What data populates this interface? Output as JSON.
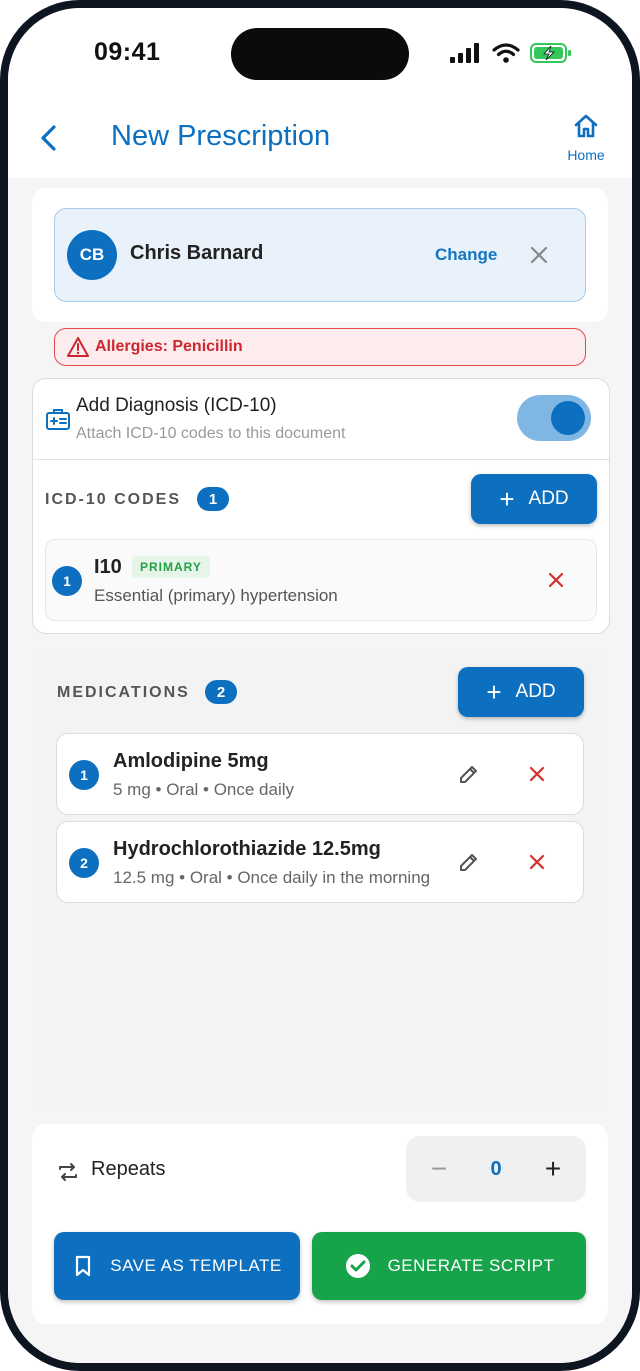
{
  "status_bar": {
    "time": "09:41"
  },
  "header": {
    "title": "New Prescription",
    "home_label": "Home"
  },
  "patient": {
    "initials": "CB",
    "name": "Chris Barnard",
    "change_label": "Change"
  },
  "allergy": {
    "text": "Allergies: Penicillin"
  },
  "diagnosis": {
    "title": "Add Diagnosis (ICD-10)",
    "subtitle": "Attach ICD-10 codes to this document",
    "enabled": true,
    "section_label": "ICD-10 CODES",
    "count": "1",
    "add_label": "ADD",
    "codes": [
      {
        "index": "1",
        "code": "I10",
        "tag": "PRIMARY",
        "description": "Essential (primary) hypertension"
      }
    ]
  },
  "medications": {
    "section_label": "MEDICATIONS",
    "count": "2",
    "add_label": "ADD",
    "items": [
      {
        "index": "1",
        "name": "Amlodipine 5mg",
        "detail": "5 mg • Oral • Once daily"
      },
      {
        "index": "2",
        "name": "Hydrochlorothiazide 12.5mg",
        "detail": "12.5 mg • Oral • Once daily in the morning"
      }
    ]
  },
  "repeats": {
    "label": "Repeats",
    "value": "0",
    "minus": "−",
    "plus": "+"
  },
  "actions": {
    "save_template": "SAVE AS TEMPLATE",
    "generate_script": "GENERATE SCRIPT"
  },
  "colors": {
    "primary": "#0d6fbf",
    "success": "#16a34a",
    "danger": "#d32f2f",
    "allergy_bg": "#fdecee"
  },
  "icons": [
    "back-chevron-icon",
    "home-icon",
    "close-icon",
    "warning-icon",
    "medical-card-icon",
    "plus-icon",
    "pencil-icon",
    "repeat-icon",
    "bookmark-icon",
    "check-circle-icon"
  ]
}
